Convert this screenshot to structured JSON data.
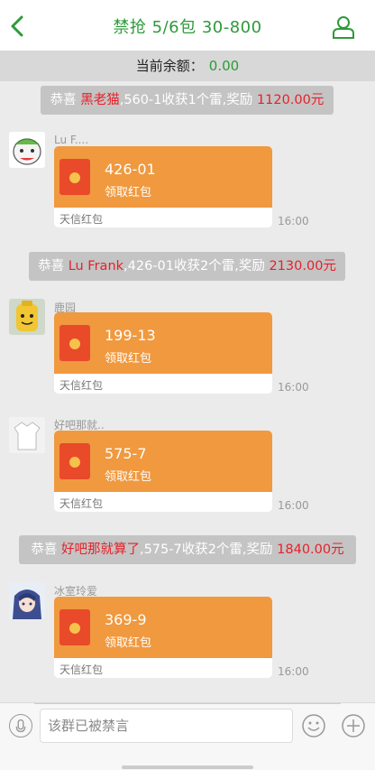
{
  "header": {
    "title": "禁抢 5/6包 30-800"
  },
  "balance": {
    "label": "当前余额：",
    "amount": "0.00"
  },
  "notices": [
    {
      "prefix": "恭喜",
      "name": "黑老猫",
      "text": ",560-1收获1个雷,奖励",
      "reward": "1120.00元"
    },
    {
      "prefix": "恭喜",
      "name": "Lu Frank",
      "text": ",426-01收获2个雷,奖励",
      "reward": "2130.00元"
    },
    {
      "prefix": "恭喜",
      "name": "好吧那就算了",
      "text": ",575-7收获2个雷,奖励",
      "reward": "1840.00元"
    }
  ],
  "messages": [
    {
      "sender": "Lu F....",
      "code": "426-01",
      "action": "领取红包",
      "brand": "天信红包",
      "time": "16:00",
      "avatar_icon": "cartoon-face-avatar"
    },
    {
      "sender": "鹿园",
      "code": "199-13",
      "action": "领取红包",
      "brand": "天信红包",
      "time": "16:00",
      "avatar_icon": "lego-head-avatar"
    },
    {
      "sender": "好吧那就..",
      "code": "575-7",
      "action": "领取红包",
      "brand": "天信红包",
      "time": "16:00",
      "avatar_icon": "white-shirt-avatar"
    },
    {
      "sender": "冰室玲爱",
      "code": "369-9",
      "action": "领取红包",
      "brand": "天信红包",
      "time": "16:00",
      "avatar_icon": "anime-girl-avatar"
    }
  ],
  "footer": {
    "placeholder": "该群已被禁言"
  },
  "colors": {
    "accent": "#2e9a3a",
    "bubble": "#f0993f",
    "highlight": "#e8202a"
  }
}
